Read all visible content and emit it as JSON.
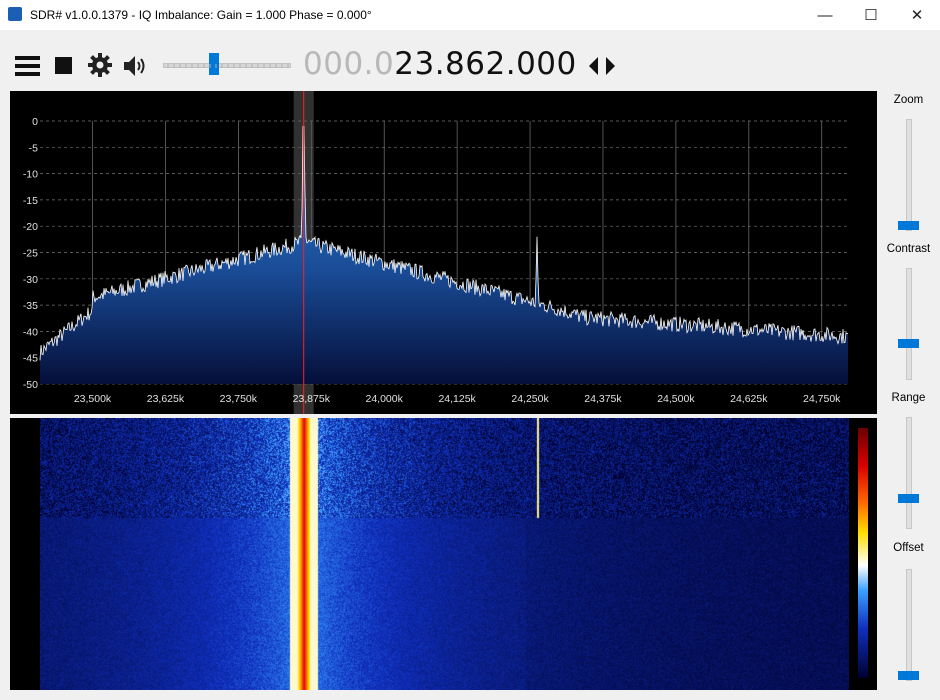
{
  "window": {
    "title": "SDR# v1.0.0.1379 - IQ Imbalance: Gain = 1.000 Phase = 0.000°",
    "minimize": "—",
    "maximize": "☐",
    "close": "✕"
  },
  "toolbar": {
    "menu_icon": "hamburger-menu-icon",
    "stop_icon": "stop-icon",
    "settings_icon": "gear-icon",
    "audio_icon": "speaker-icon",
    "volume_level": 0.4,
    "frequency_dim": "000.0",
    "frequency_bright": "23.862.000",
    "tune_arrows": "◂▸"
  },
  "spectrum": {
    "y_ticks": [
      "0",
      "-5",
      "-10",
      "-15",
      "-20",
      "-25",
      "-30",
      "-35",
      "-40",
      "-45",
      "-50"
    ],
    "x_ticks": [
      "23,500k",
      "23,625k",
      "23,750k",
      "23,875k",
      "24,000k",
      "24,125k",
      "24,250k",
      "24,375k",
      "24,500k",
      "24,625k",
      "24,750k"
    ],
    "x_values_khz": [
      23500,
      23625,
      23750,
      23875,
      24000,
      24125,
      24250,
      24375,
      24500,
      24625,
      24750
    ],
    "x_range_khz": [
      23410,
      24795
    ],
    "y_range_db": [
      -50,
      0
    ],
    "center_khz": 23862,
    "spur_khz": 24262
  },
  "side": {
    "zoom_label": "Zoom",
    "contrast_label": "Contrast",
    "range_label": "Range",
    "offset_label": "Offset",
    "zoom_level": 0.0,
    "contrast_level": 0.3,
    "range_level": 0.25,
    "offset_level": 0.0
  },
  "colors": {
    "accent": "#0078d7",
    "carrier_marker": "#ff2020",
    "spectrum_fill": "#1e6bb0"
  }
}
